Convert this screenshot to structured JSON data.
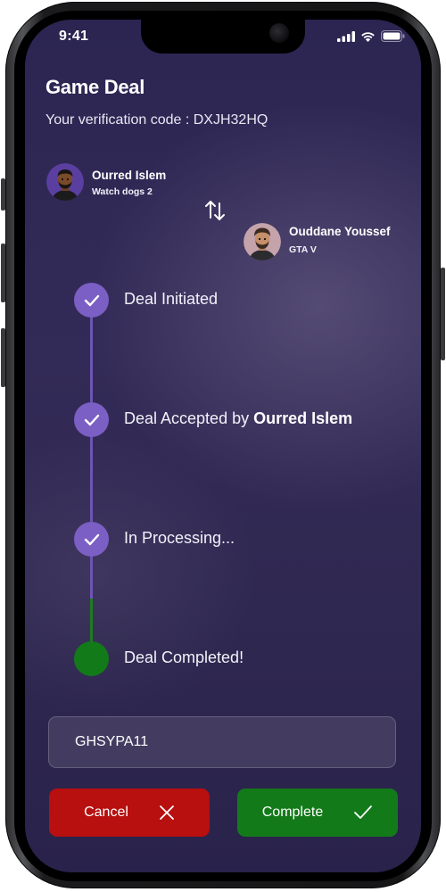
{
  "status_bar": {
    "time": "9:41"
  },
  "header": {
    "title": "Game Deal",
    "verification_label": "Your verification code : ",
    "verification_code": "DXJH32HQ"
  },
  "deal": {
    "user_a": {
      "name": "Ourred Islem",
      "game": "Watch dogs 2"
    },
    "user_b": {
      "name": "Ouddane Youssef",
      "game": "GTA V"
    }
  },
  "steps": [
    {
      "label": "Deal Initiated",
      "status": "done"
    },
    {
      "label_prefix": "Deal Accepted by ",
      "label_strong": "Ourred Islem",
      "status": "done"
    },
    {
      "label": "In Processing...",
      "status": "done"
    },
    {
      "label": "Deal Completed!",
      "status": "completed"
    }
  ],
  "code_input": {
    "value": "GHSYPA11"
  },
  "actions": {
    "cancel_label": "Cancel",
    "complete_label": "Complete"
  },
  "colors": {
    "background": "#2f2850",
    "accent_purple": "#7b5fc4",
    "complete_green": "#137a1a",
    "cancel_red": "#b80f0f"
  }
}
